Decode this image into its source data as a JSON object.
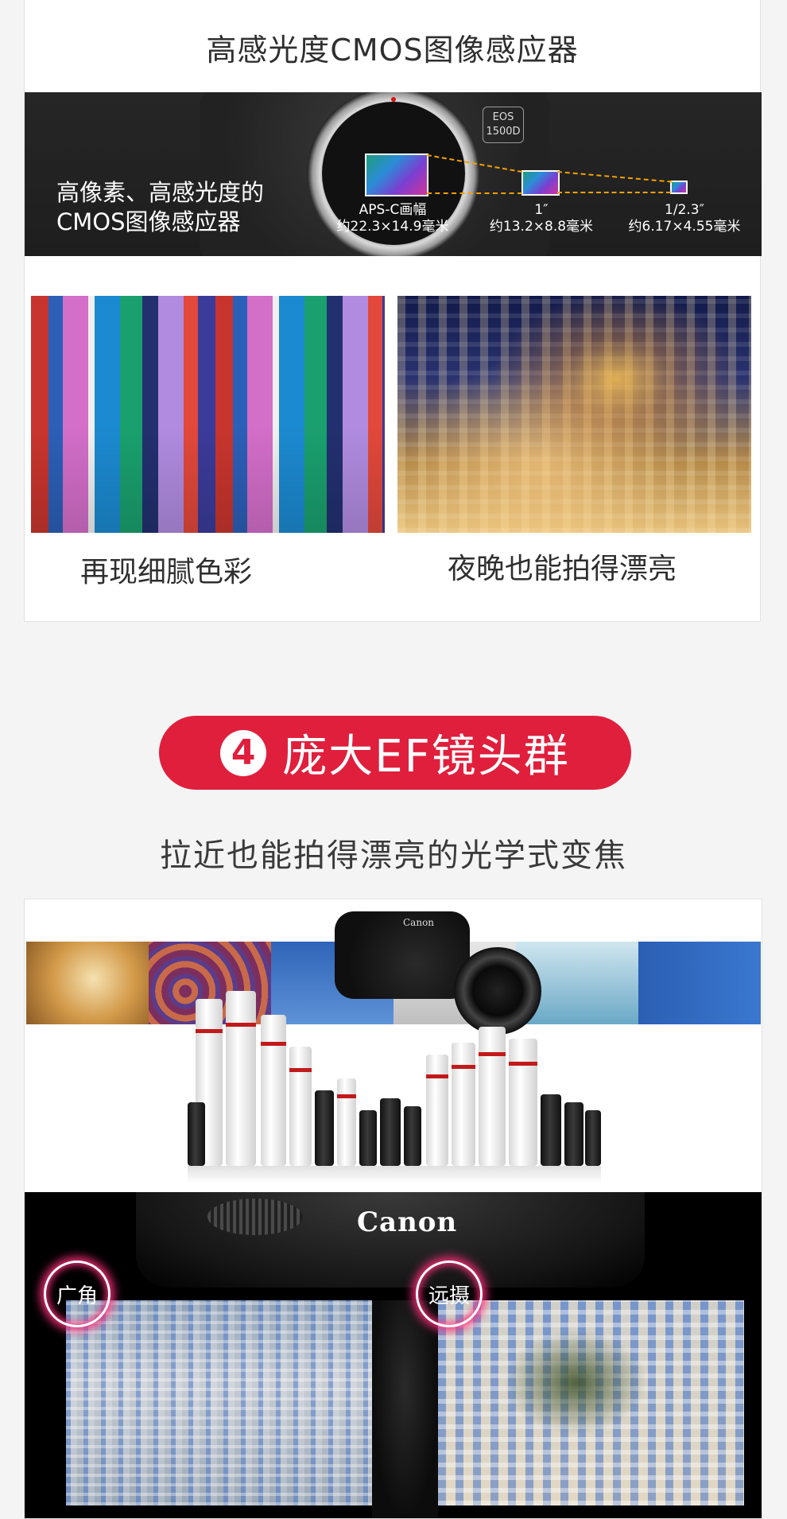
{
  "section_sensor": {
    "title": "高感光度CMOS图像感应器",
    "banner_text_line1": "高像素、高感光度的",
    "banner_text_line2": "CMOS图像感应器",
    "camera_badge": "EOS\n1500D",
    "sensors": [
      {
        "name_line": "APS-C画幅",
        "size_line": "约22.3×14.9毫米"
      },
      {
        "name_line": "1″",
        "size_line": "约13.2×8.8毫米"
      },
      {
        "name_line": "1/2.3″",
        "size_line": "约6.17×4.55毫米"
      }
    ],
    "captions": [
      "再现细腻色彩",
      "夜晚也能拍得漂亮"
    ]
  },
  "section_lens": {
    "number": "4",
    "heading": "庞大EF镜头群",
    "subtitle": "拉近也能拍得漂亮的光学式变焦",
    "brand_logo": "Canon",
    "brand_logo_small": "Canon",
    "badges": {
      "wide": "广角",
      "tele": "远摄"
    }
  },
  "colors": {
    "accent_red": "#e01f3d",
    "sensor_line": "#f3a100",
    "badge_glow": "#ff2d7a"
  }
}
